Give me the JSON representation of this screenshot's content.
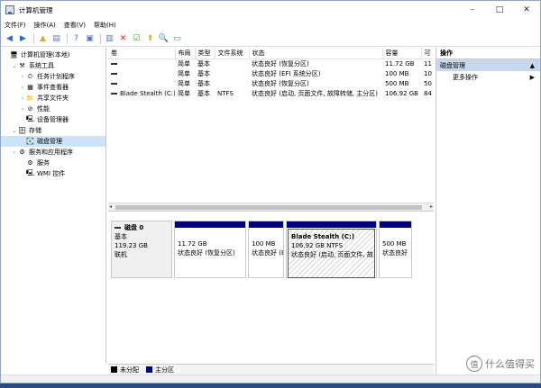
{
  "window": {
    "title": "计算机管理",
    "minimize": "–",
    "maximize": "□",
    "close": "✕"
  },
  "menu": [
    "文件(F)",
    "操作(A)",
    "查看(V)",
    "帮助(H)"
  ],
  "toolbar": {
    "icons": [
      "back-icon",
      "forward-icon",
      "up-folder-icon",
      "show-hide-tree-icon",
      "help-icon",
      "properties-icon",
      "connect-icon",
      "delete-icon",
      "checklist-icon",
      "export-icon",
      "help-book-icon",
      "view-icon"
    ],
    "glyphs": [
      "◀",
      "▶",
      "▲",
      "▤",
      "?",
      "▣",
      "▥",
      "✕",
      "☑",
      "⬆",
      "🔍",
      "▭"
    ],
    "colors": [
      "#2a6ebd",
      "#2a6ebd",
      "#d9a43b",
      "#5b79a8",
      "#3b6fc4",
      "#5b79a8",
      "#5b79a8",
      "#d21f1f",
      "#4d8a3e",
      "#d9a43b",
      "#c9a200",
      "#5b79a8"
    ]
  },
  "tree": [
    {
      "label": "计算机管理(本地)",
      "indent": 0,
      "arrow": "",
      "icon": "🖥",
      "name": "computer-mgmt-root"
    },
    {
      "label": "系统工具",
      "indent": 1,
      "arrow": "⌄",
      "icon": "⚒",
      "name": "system-tools"
    },
    {
      "label": "任务计划程序",
      "indent": 2,
      "arrow": "›",
      "icon": "⏲",
      "name": "task-scheduler"
    },
    {
      "label": "事件查看器",
      "indent": 2,
      "arrow": "›",
      "icon": "▦",
      "name": "event-viewer"
    },
    {
      "label": "共享文件夹",
      "indent": 2,
      "arrow": "›",
      "icon": "📁",
      "name": "shared-folders"
    },
    {
      "label": "性能",
      "indent": 2,
      "arrow": "›",
      "icon": "⊘",
      "name": "performance"
    },
    {
      "label": "设备管理器",
      "indent": 2,
      "arrow": "",
      "icon": "🖳",
      "name": "device-manager"
    },
    {
      "label": "存储",
      "indent": 1,
      "arrow": "⌄",
      "icon": "🗄",
      "name": "storage"
    },
    {
      "label": "磁盘管理",
      "indent": 2,
      "arrow": "",
      "icon": "💽",
      "name": "disk-management",
      "selected": true
    },
    {
      "label": "服务和应用程序",
      "indent": 1,
      "arrow": "›",
      "icon": "⚙",
      "name": "services-apps"
    },
    {
      "label": "服务",
      "indent": 2,
      "arrow": "",
      "icon": "⚙",
      "name": "services"
    },
    {
      "label": "WMI 控件",
      "indent": 2,
      "arrow": "",
      "icon": "🖳",
      "name": "wmi-control"
    }
  ],
  "volumes": {
    "headers": [
      "卷",
      "布局",
      "类型",
      "文件系统",
      "状态",
      "容量",
      "可"
    ],
    "rows": [
      [
        "",
        "简单",
        "基本",
        "",
        "状态良好 (恢复分区)",
        "11.72 GB",
        "11"
      ],
      [
        "",
        "简单",
        "基本",
        "",
        "状态良好 (EFI 系统分区)",
        "100 MB",
        "10"
      ],
      [
        "",
        "简单",
        "基本",
        "",
        "状态良好 (恢复分区)",
        "500 MB",
        "50"
      ],
      [
        "Blade Stealth (C:)",
        "简单",
        "基本",
        "NTFS",
        "状态良好 (启动, 页面文件, 故障转储, 主分区)",
        "106.92 GB",
        "84"
      ]
    ]
  },
  "disk": {
    "name": "磁盘 0",
    "type": "基本",
    "size": "119.23 GB",
    "state": "联机",
    "partitions": [
      {
        "title": "",
        "size": "11.72 GB",
        "status": "状态良好 (恢复分区)",
        "w": 80
      },
      {
        "title": "",
        "size": "100 MB",
        "status": "状态良好 (E",
        "w": 40
      },
      {
        "title": "Blade Stealth  (C:)",
        "size": "106.92 GB NTFS",
        "status": "状态良好 (启动, 页面文件, 故",
        "w": 101,
        "selected": true
      },
      {
        "title": "",
        "size": "500 MB",
        "status": "状态良好",
        "w": 37
      }
    ]
  },
  "legend": [
    {
      "label": "未分配",
      "color": "#000000"
    },
    {
      "label": "主分区",
      "color": "#00007d"
    }
  ],
  "actions": {
    "header": "操作",
    "section": "磁盘管理",
    "items": [
      "更多操作"
    ]
  },
  "watermark": {
    "mark": "值",
    "text": "什么值得买"
  }
}
